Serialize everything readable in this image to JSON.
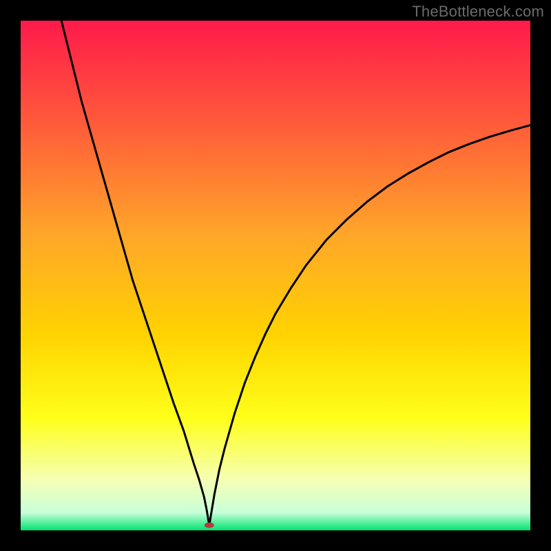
{
  "watermark": "TheBottleneck.com",
  "chart_data": {
    "type": "line",
    "title": "",
    "xlabel": "",
    "ylabel": "",
    "xlim": [
      0,
      100
    ],
    "ylim": [
      0,
      100
    ],
    "grid": false,
    "legend": false,
    "background_gradient": {
      "stops": [
        {
          "offset": 0.0,
          "color": "#ff1a4b"
        },
        {
          "offset": 0.2,
          "color": "#ff5a3a"
        },
        {
          "offset": 0.42,
          "color": "#ffa629"
        },
        {
          "offset": 0.62,
          "color": "#ffd400"
        },
        {
          "offset": 0.78,
          "color": "#ffff1a"
        },
        {
          "offset": 0.9,
          "color": "#f6ffb3"
        },
        {
          "offset": 0.965,
          "color": "#c8ffda"
        },
        {
          "offset": 1.0,
          "color": "#00e36f"
        }
      ]
    },
    "marker": {
      "x": 37,
      "y": 1,
      "color": "#b63a3a",
      "rx": 7,
      "ry": 4
    },
    "series": [
      {
        "name": "curve",
        "x": [
          8,
          10,
          12,
          14,
          16,
          18,
          20,
          22,
          24,
          26,
          28,
          30,
          32,
          34,
          35,
          36,
          36.5,
          37,
          37.5,
          38,
          39,
          40,
          42,
          44,
          46,
          48,
          50,
          53,
          56,
          60,
          64,
          68,
          72,
          76,
          80,
          84,
          88,
          92,
          96,
          100
        ],
        "values": [
          100,
          92,
          84,
          77,
          70,
          63,
          56,
          49,
          43,
          37,
          31,
          25,
          19.5,
          13,
          10,
          6.5,
          4,
          1,
          4,
          7,
          12,
          16,
          23,
          29,
          34,
          38.5,
          42.5,
          47.5,
          52,
          57,
          61,
          64.5,
          67.5,
          70,
          72.2,
          74.2,
          75.8,
          77.2,
          78.4,
          79.5
        ]
      }
    ]
  }
}
